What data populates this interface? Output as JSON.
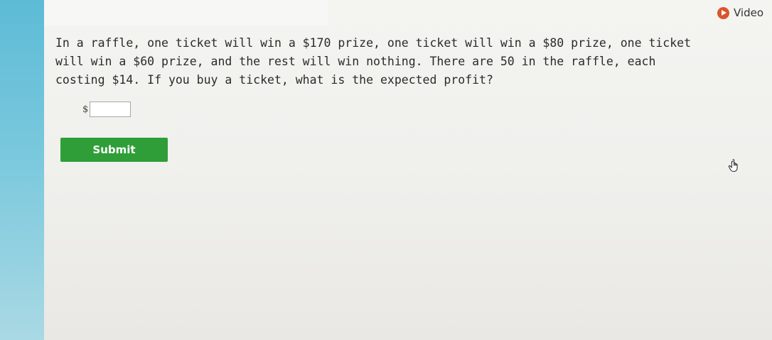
{
  "header": {
    "video_label": "Video",
    "video_icon": "play-icon",
    "video_icon_color": "#d9562e"
  },
  "question": {
    "text": "In a raffle, one ticket will win a $170 prize, one ticket will win a $80 prize, one ticket will win a $60 prize, and the rest will win nothing. There are 50 in the raffle, each costing $14. If you buy a ticket, what is the expected profit?"
  },
  "answer": {
    "currency_symbol": "$",
    "value": "",
    "placeholder": ""
  },
  "submit": {
    "label": "Submit",
    "color": "#2f9e38"
  },
  "pointer": {
    "icon": "hand-pointer-icon"
  }
}
